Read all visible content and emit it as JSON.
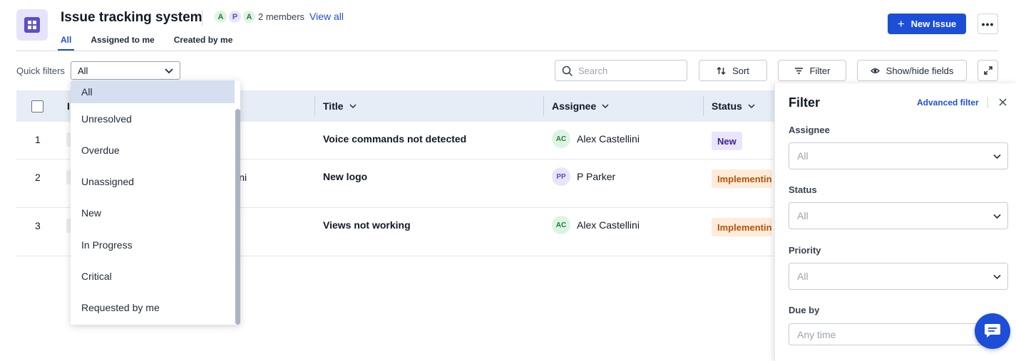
{
  "header": {
    "title": "Issue tracking system",
    "member_avatars": [
      "A",
      "P",
      "A"
    ],
    "members_text": "2 members",
    "view_all": "View all",
    "new_issue_label": "New Issue",
    "more_label": "•••"
  },
  "tabs": [
    {
      "label": "All",
      "active": true
    },
    {
      "label": "Assigned to me",
      "active": false
    },
    {
      "label": "Created by me",
      "active": false
    }
  ],
  "toolbar": {
    "quick_filters_label": "Quick filters",
    "quick_filter_value": "All",
    "search_placeholder": "Search",
    "sort_label": "Sort",
    "filter_label": "Filter",
    "showhide_label": "Show/hide fields"
  },
  "table": {
    "columns": {
      "id_fragment": "I",
      "title": "Title",
      "assignee": "Assignee",
      "status": "Status"
    },
    "rows": [
      {
        "num": "1",
        "title": "Voice commands not detected",
        "assignee_initials": "AC",
        "assignee": "Alex Castellini",
        "status": "New",
        "reporter_fragment": ""
      },
      {
        "num": "2",
        "title": "New logo",
        "assignee_initials": "PP",
        "assignee": "P Parker",
        "status": "Implementing",
        "reporter_fragment": "lini"
      },
      {
        "num": "3",
        "title": "Views not working",
        "assignee_initials": "AC",
        "assignee": "Alex Castellini",
        "status": "Implementing",
        "reporter_fragment": ""
      }
    ]
  },
  "quick_filter_options": [
    "All",
    "Unresolved",
    "Overdue",
    "Unassigned",
    "New",
    "In Progress",
    "Critical",
    "Requested by me"
  ],
  "filter_panel": {
    "title": "Filter",
    "advanced_filter": "Advanced filter",
    "fields": [
      {
        "label": "Assignee",
        "value": "All"
      },
      {
        "label": "Status",
        "value": "All"
      },
      {
        "label": "Priority",
        "value": "All"
      }
    ],
    "due_by_label": "Due by",
    "due_by_placeholder": "Any time"
  },
  "colors": {
    "accent": "#1d4ed8",
    "header_bg": "#e7edf6",
    "badge_new_bg": "#ebe5fc",
    "badge_impl_bg": "#fdecd9"
  }
}
